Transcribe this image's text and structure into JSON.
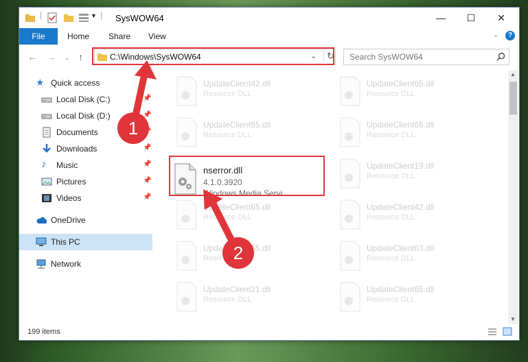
{
  "window": {
    "title": "SysWOW64",
    "controls": {
      "minimize": "—",
      "maximize": "☐",
      "close": "✕"
    }
  },
  "ribbon": {
    "file": "File",
    "tabs": [
      "Home",
      "Share",
      "View"
    ]
  },
  "nav": {
    "address": "C:\\Windows\\SysWOW64",
    "search_placeholder": "Search SysWOW64"
  },
  "sidebar": {
    "quick_access": "Quick access",
    "items": [
      {
        "label": "Local Disk (C:)",
        "icon": "drive-icon"
      },
      {
        "label": "Local Disk (D:)",
        "icon": "drive-icon"
      },
      {
        "label": "Documents",
        "icon": "documents-icon"
      },
      {
        "label": "Downloads",
        "icon": "download-icon"
      },
      {
        "label": "Music",
        "icon": "music-icon"
      },
      {
        "label": "Pictures",
        "icon": "pictures-icon"
      },
      {
        "label": "Videos",
        "icon": "videos-icon"
      }
    ],
    "onedrive": "OneDrive",
    "this_pc": "This PC",
    "network": "Network"
  },
  "files": {
    "featured": {
      "name": "nserror.dll",
      "version": "4.1.0.3920",
      "desc": "Windows Media Servi..."
    },
    "left": [
      {
        "name": "UpdateClient42.dll",
        "desc": "Resource DLL"
      },
      {
        "name": "UpdateClient65.dll",
        "desc": "Resource DLL"
      },
      {
        "name": "UpdateClient65.dll",
        "desc": "Resource DLL"
      },
      {
        "name": "UpdateClient65.dll",
        "desc": "Resource DLL"
      },
      {
        "name": "UpdateClient21.dll",
        "desc": "Resource DLL"
      }
    ],
    "right": [
      {
        "name": "UpdateClient65.dll",
        "desc": "Resource DLL"
      },
      {
        "name": "UpdateClient65.dll",
        "desc": "Resource DLL"
      },
      {
        "name": "UpdateClient19.dll",
        "desc": "Resource DLL"
      },
      {
        "name": "UpdateClient42.dll",
        "desc": "Resource DLL"
      },
      {
        "name": "UpdateClient63.dll",
        "desc": "Resource DLL"
      },
      {
        "name": "UpdateClient65.dll",
        "desc": "Resource DLL"
      }
    ]
  },
  "status": {
    "count": "199 items"
  },
  "annotations": {
    "step1": "1",
    "step2": "2"
  },
  "colors": {
    "accent": "#1979ca",
    "highlight": "#e0353a",
    "selected": "#cce4f7"
  }
}
